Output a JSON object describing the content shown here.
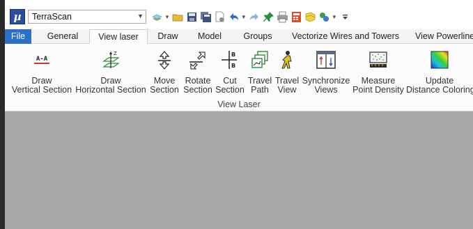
{
  "window": {
    "workspace_selector": {
      "value": "TerraScan"
    }
  },
  "quick_access": {
    "icons": [
      "layers-icon",
      "open-folder-icon",
      "save-icon",
      "save-all-icon",
      "document-icon",
      "undo-icon",
      "redo-icon",
      "pin-icon",
      "print-icon",
      "calculator-icon",
      "models-icon",
      "network-icon",
      "customize-icon"
    ]
  },
  "tabs": [
    {
      "label": "File"
    },
    {
      "label": "General"
    },
    {
      "label": "View laser"
    },
    {
      "label": "Draw"
    },
    {
      "label": "Model"
    },
    {
      "label": "Groups"
    },
    {
      "label": "Vectorize Wires and Towers"
    },
    {
      "label": "View Powerline"
    }
  ],
  "active_tab": "View laser",
  "ribbon": {
    "group_label": "View Laser",
    "buttons": [
      {
        "line1": "Draw",
        "line2": "Vertical Section",
        "icon": "vertical-section-icon"
      },
      {
        "line1": "Draw",
        "line2": "Horizontal Section",
        "icon": "horizontal-section-icon"
      },
      {
        "line1": "Move",
        "line2": "Section",
        "icon": "move-section-icon"
      },
      {
        "line1": "Rotate",
        "line2": "Section",
        "icon": "rotate-section-icon"
      },
      {
        "line1": "Cut",
        "line2": "Section",
        "icon": "cut-section-icon"
      },
      {
        "line1": "Travel",
        "line2": "Path",
        "icon": "travel-path-icon"
      },
      {
        "line1": "Travel",
        "line2": "View",
        "icon": "travel-view-icon"
      },
      {
        "line1": "Synchronize",
        "line2": "Views",
        "icon": "synchronize-views-icon"
      },
      {
        "line1": "Measure",
        "line2": "Point Density",
        "icon": "point-density-icon"
      },
      {
        "line1": "Update",
        "line2": "Distance Coloring",
        "icon": "distance-coloring-icon"
      }
    ]
  },
  "colors": {
    "file_tab": "#2b6fc6",
    "workspace_bg": "#a9a9a9",
    "left_strip": "#2b2b2b"
  }
}
